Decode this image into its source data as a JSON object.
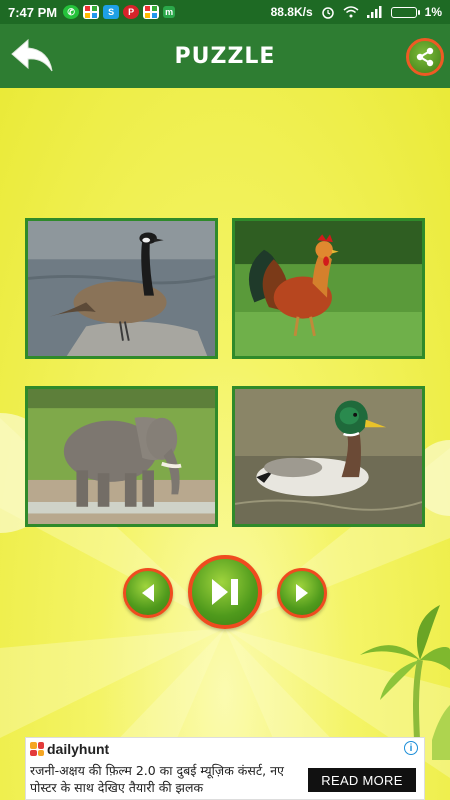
{
  "status_bar": {
    "time": "7:47 PM",
    "network_speed": "88.8K/s",
    "battery": "1%",
    "notification_icons": [
      "whatsapp-icon",
      "grid-app-icon",
      "skype-icon",
      "pinterest-icon",
      "grid-app-icon",
      "m-app-icon"
    ]
  },
  "app_bar": {
    "title": "PUZZLE",
    "back_icon": "back-arrow-icon",
    "share_icon": "share-icon"
  },
  "tiles": [
    {
      "subject": "goose"
    },
    {
      "subject": "rooster"
    },
    {
      "subject": "elephant"
    },
    {
      "subject": "duck"
    }
  ],
  "controls": {
    "previous_icon": "previous-icon",
    "play_icon": "play-pause-icon",
    "next_icon": "next-icon"
  },
  "ad": {
    "brand": "dailyhunt",
    "headline": "रजनी-अक्षय की फ़िल्म 2.0 का दुबई म्यूज़िक कंसर्ट, नए पोस्टर के साथ देखिए तैयारी की झलक",
    "cta": "READ MORE",
    "info_icon": "info-icon"
  },
  "colors": {
    "app_bar": "#2e7d32",
    "status_bar": "#1e6a24",
    "background": "#f2f25a",
    "tile_border": "#2f8a2a",
    "button_ring": "#ef4b1f",
    "button_fill": "#5fa81f"
  }
}
